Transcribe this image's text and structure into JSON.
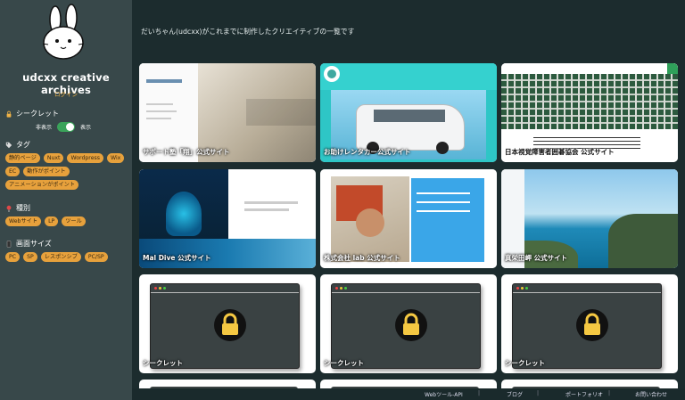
{
  "sidebar": {
    "title": "udcxx creative archives",
    "login": "ログイン",
    "secret": {
      "title": "シークレット",
      "off_label": "非表示",
      "on_label": "表示",
      "enabled": true
    },
    "tags": {
      "title": "タグ",
      "items": [
        "静的ページ",
        "Nuxt",
        "Wordpress",
        "Wix",
        "EC",
        "動作がポイント",
        "アニメーションがポイント"
      ]
    },
    "types": {
      "title": "種別",
      "items": [
        "Webサイト",
        "LP",
        "ツール"
      ]
    },
    "sizes": {
      "title": "画面サイズ",
      "items": [
        "PC",
        "SP",
        "レスポンシブ",
        "PC/SP"
      ]
    }
  },
  "main": {
    "heading": "だいちゃん(udcxx)がこれまでに制作したクリエイティブの一覧です",
    "cards": [
      {
        "label": "サポート塾「翔」公式サイト"
      },
      {
        "label": "お助けレンタカー公式サイト"
      },
      {
        "label": "日本視覚障害者囲碁協会 公式サイト"
      },
      {
        "label": "Mal Dive 公式サイト"
      },
      {
        "label": "株式会社 lab 公式サイト"
      },
      {
        "label": "真栄田岬 公式サイト"
      },
      {
        "label": "シークレット"
      },
      {
        "label": "シークレット"
      },
      {
        "label": "シークレット"
      }
    ]
  },
  "footer": {
    "links": [
      "Webツール-API",
      "ブログ",
      "ポートフォリオ",
      "お問い合わせ"
    ]
  },
  "colors": {
    "accent": "#e7a13c",
    "toggle_on": "#3aa35a",
    "sidebar_bg": "#38484a",
    "main_bg": "#1c2c2e"
  }
}
